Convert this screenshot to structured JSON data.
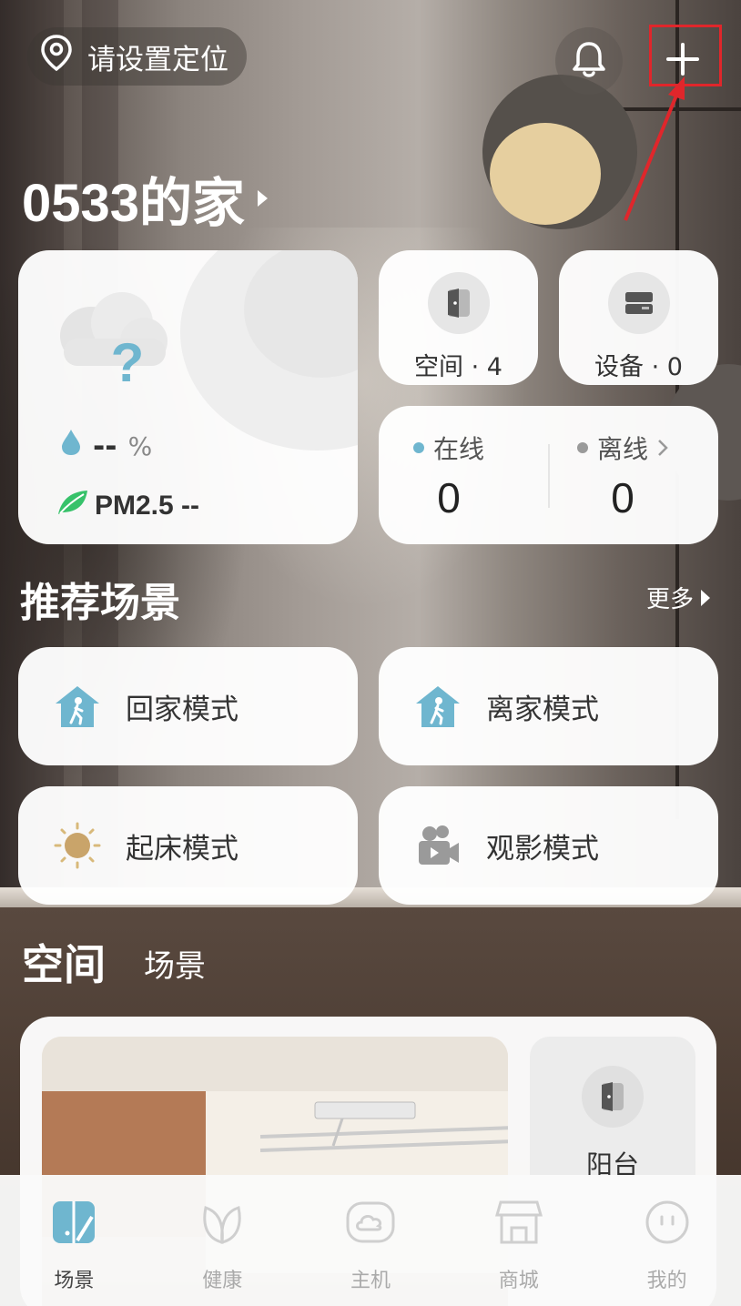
{
  "header": {
    "location_label": "请设置定位",
    "home_title": "0533的家"
  },
  "weather": {
    "humidity_value": "--",
    "humidity_unit": "%",
    "pm_label": "PM2.5 --"
  },
  "stats": {
    "spaces": "空间 · 4",
    "devices": "设备 · 0",
    "online_label": "在线",
    "online_count": "0",
    "offline_label": "离线",
    "offline_count": "0"
  },
  "recommended": {
    "title": "推荐场景",
    "more": "更多",
    "scenes": [
      {
        "label": "回家模式",
        "icon": "house-walk-icon"
      },
      {
        "label": "离家模式",
        "icon": "house-walk-icon"
      },
      {
        "label": "起床模式",
        "icon": "sun-icon"
      },
      {
        "label": "观影模式",
        "icon": "movie-camera-icon"
      }
    ]
  },
  "tabs": {
    "space": "空间",
    "scene": "场景"
  },
  "rooms": [
    {
      "name": "阳台",
      "icon": "door-icon"
    }
  ],
  "nav": [
    {
      "label": "场景",
      "icon": "scene-icon",
      "active": true
    },
    {
      "label": "健康",
      "icon": "leaf-icon",
      "active": false
    },
    {
      "label": "主机",
      "icon": "cloud-hub-icon",
      "active": false
    },
    {
      "label": "商城",
      "icon": "store-icon",
      "active": false
    },
    {
      "label": "我的",
      "icon": "profile-face-icon",
      "active": false
    }
  ],
  "colors": {
    "accent": "#6fb6cf",
    "annotation": "#e0262b",
    "online_dot": "#6fb6cf",
    "offline_dot": "#9a9a9a",
    "leaf": "#37c26a"
  }
}
